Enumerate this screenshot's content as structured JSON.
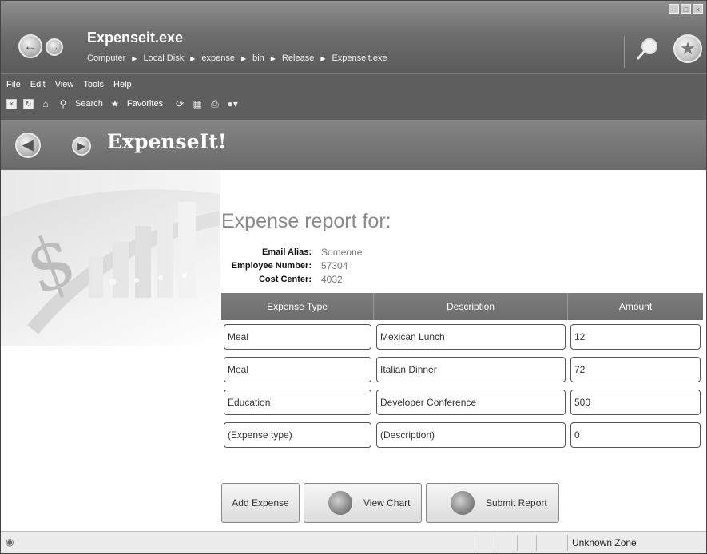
{
  "window": {
    "title": "Expenseit.exe",
    "breadcrumbs": [
      "Computer",
      "Local Disk",
      "expense",
      "bin",
      "Release",
      "Expenseit.exe"
    ]
  },
  "menu": [
    "File",
    "Edit",
    "View",
    "Tools",
    "Help"
  ],
  "toolbar": {
    "search_label": "Search",
    "favorites_label": "Favorites"
  },
  "page": {
    "title": "ExpenseIt!"
  },
  "report": {
    "heading": "Expense report for:",
    "email_label": "Email Alias:",
    "email_value": "Someone",
    "employee_label": "Employee Number:",
    "employee_value": "57304",
    "cost_label": "Cost Center:",
    "cost_value": "4032"
  },
  "table": {
    "headers": [
      "Expense Type",
      "Description",
      "Amount"
    ],
    "rows": [
      {
        "type": "Meal",
        "description": "Mexican Lunch",
        "amount": "12"
      },
      {
        "type": "Meal",
        "description": "Italian Dinner",
        "amount": "72"
      },
      {
        "type": "Education",
        "description": "Developer Conference",
        "amount": "500"
      },
      {
        "type": "(Expense type)",
        "description": "(Description)",
        "amount": "0"
      }
    ]
  },
  "buttons": {
    "add_expense": "Add Expense",
    "view_chart": "View Chart",
    "submit_report": "Submit Report"
  },
  "status": {
    "zone": "Unknown Zone"
  },
  "icons": {
    "back": "back-arrow-icon",
    "forward": "forward-arrow-icon",
    "search": "magnifier-icon",
    "favorites": "star-icon"
  }
}
